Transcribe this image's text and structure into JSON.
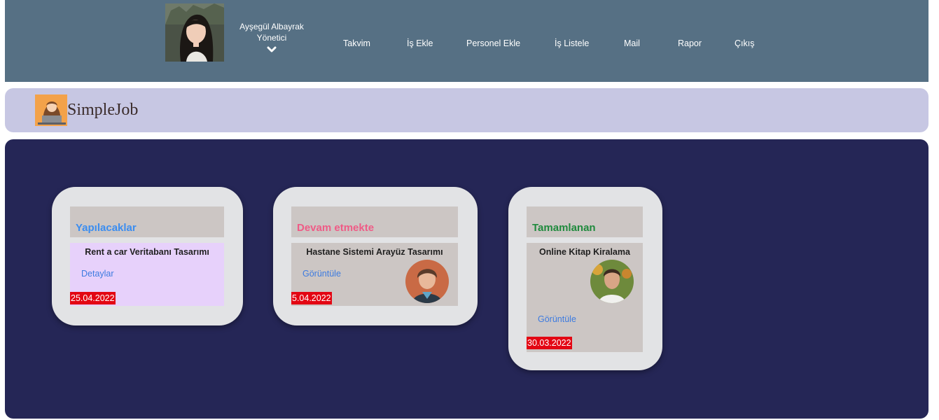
{
  "user": {
    "name": "Ayşegül Albayrak",
    "role": "Yönetici"
  },
  "nav": {
    "items": [
      {
        "label": "Takvim"
      },
      {
        "label": "İş Ekle"
      },
      {
        "label": "Personel Ekle"
      },
      {
        "label": "İş Listele"
      },
      {
        "label": "Mail"
      },
      {
        "label": "Rapor"
      },
      {
        "label": "Çıkış"
      }
    ]
  },
  "brand": {
    "name": "SimpleJob"
  },
  "columns": [
    {
      "title": "Yapılacaklar",
      "title_color": "#3b8df0",
      "task": {
        "title": "Rent a car Veritabanı Tasarımı",
        "link": "Detaylar",
        "date": "25.04.2022"
      }
    },
    {
      "title": "Devam etmekte",
      "title_color": "#ef5b86",
      "task": {
        "title": "Hastane Sistemi Arayüz Tasarımı",
        "link": "Görüntüle",
        "date": "5.04.2022"
      }
    },
    {
      "title": "Tamamlanan",
      "title_color": "#1f8a3d",
      "task": {
        "title": "Online Kitap Kiralama",
        "link": "Görüntüle",
        "date": "30.03.2022"
      }
    }
  ],
  "colors": {
    "navbar": "#567084",
    "logobar": "#c7c7e3",
    "board": "#252656",
    "card": "#e2e3e5",
    "date_badge": "#e30613",
    "link": "#3d7be0"
  }
}
